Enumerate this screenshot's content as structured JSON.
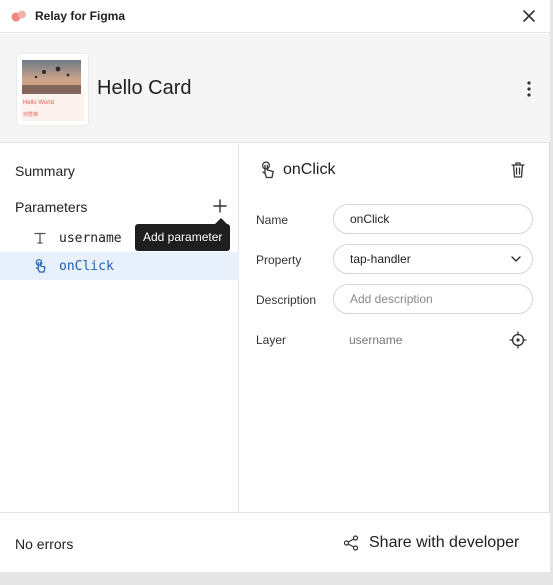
{
  "app": {
    "title": "Relay for Figma"
  },
  "header": {
    "card_title": "Hello Card",
    "thumbnail": {
      "line1": "Hello World",
      "line2": "何慧祺"
    }
  },
  "left": {
    "summary_label": "Summary",
    "parameters_label": "Parameters",
    "parameters": [
      {
        "name": "username",
        "icon": "text-type-icon",
        "selected": false
      },
      {
        "name": "onClick",
        "icon": "tap-gesture-icon",
        "selected": true
      }
    ],
    "tooltip": "Add parameter"
  },
  "detail": {
    "title": "onClick",
    "fields": {
      "name_label": "Name",
      "name_value": "onClick",
      "property_label": "Property",
      "property_value": "tap-handler",
      "description_label": "Description",
      "description_placeholder": "Add description",
      "layer_label": "Layer",
      "layer_value": "username"
    }
  },
  "footer": {
    "status": "No errors",
    "share_label": "Share with developer"
  },
  "colors": {
    "selection_bg": "#e8f0fb",
    "selection_text": "#1f5fb8",
    "tooltip_bg": "#1e1e1e"
  }
}
